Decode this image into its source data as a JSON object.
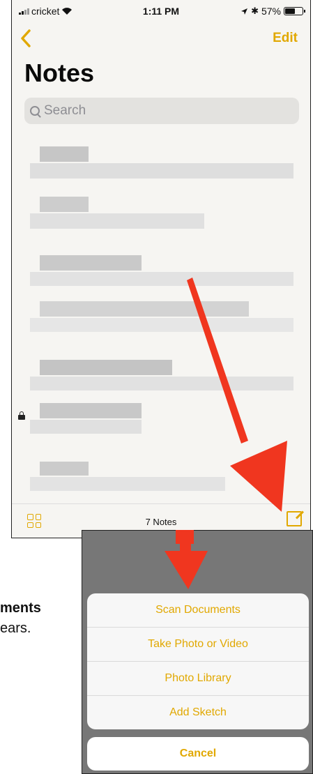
{
  "status_bar": {
    "carrier": "cricket",
    "time": "1:11 PM",
    "battery": "57%"
  },
  "nav": {
    "back_label": "<",
    "edit_label": "Edit"
  },
  "title": "Notes",
  "search": {
    "placeholder": "Search"
  },
  "notes_count": "7 Notes",
  "action_sheet": {
    "items": [
      "Scan Documents",
      "Take Photo or Video",
      "Photo Library",
      "Add Sketch"
    ],
    "cancel": "Cancel"
  },
  "background_text": {
    "line1": "ments",
    "line2": "ears."
  },
  "colors": {
    "accent": "#e1a800",
    "arrow": "#f0361f"
  },
  "icons": [
    "back-chevron-icon",
    "search-icon",
    "lock-icon",
    "gallery-grid-icon",
    "compose-icon",
    "wifi-icon",
    "location-icon",
    "bluetooth-icon",
    "battery-icon"
  ]
}
